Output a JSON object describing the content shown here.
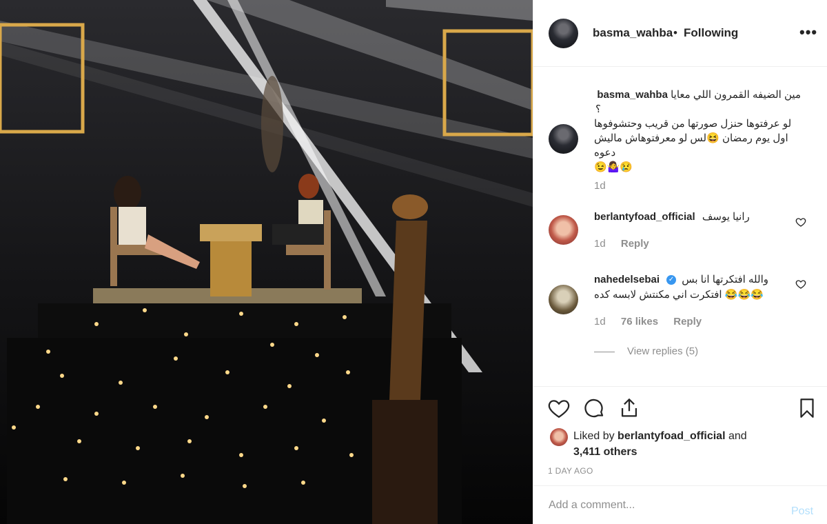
{
  "post": {
    "username": "basma_wahba",
    "separator": "•",
    "follow_status": "Following",
    "more_label": "•••"
  },
  "caption": {
    "username": "basma_wahba",
    "line1": "مين الضيفه القمرون اللي معايا",
    "line2": "؟",
    "line3": "لو عرفتوها حنزل صورتها من قريب وحتشوفوها",
    "line4": "اول يوم رمضان 😆لس لو معرفتوهاش ماليش دعوه",
    "line5": "😢🤷‍♀️😉",
    "age": "1d"
  },
  "comments": [
    {
      "username": "berlantyfoad_official",
      "text": "رانيا يوسف",
      "age": "1d",
      "reply_label": "Reply"
    },
    {
      "username": "nahedelsebai",
      "verified": "✓",
      "text_line1": "والله افتكرتها انا بس",
      "text_line2": "افتكرت اني مكنتش لابسه كده 😂😂😂",
      "age": "1d",
      "likes": "76 likes",
      "reply_label": "Reply",
      "view_replies": "View replies (5)"
    }
  ],
  "actions": {
    "liked_by_prefix": "Liked by",
    "liked_by_user": "berlantyfoad_official",
    "liked_by_suffix": "and",
    "others": "3,411 others",
    "timestamp": "1 DAY AGO"
  },
  "composer": {
    "placeholder": "Add a comment...",
    "post_label": "Post"
  },
  "colors": {
    "link_disabled": "#b2dffc",
    "verified": "#3897f0",
    "muted": "#8e8e8e",
    "text": "#262626"
  },
  "icons": [
    "heart-icon",
    "comment-icon",
    "share-icon",
    "bookmark-icon",
    "more-options-icon",
    "verified-badge-icon"
  ]
}
